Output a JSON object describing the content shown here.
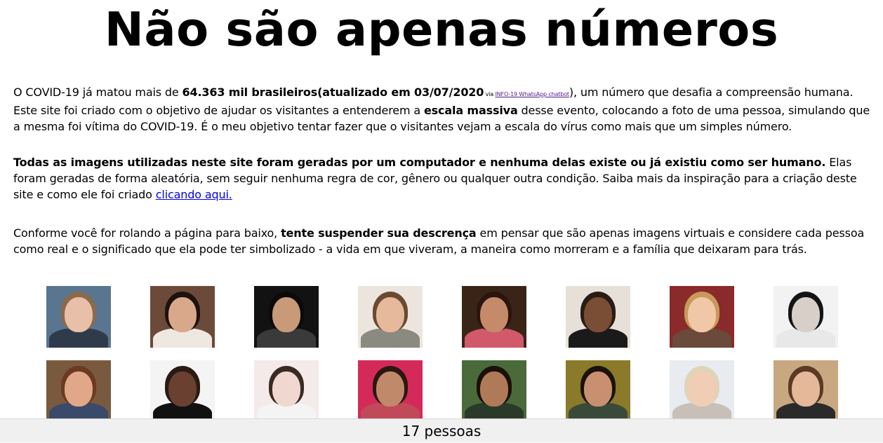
{
  "page": {
    "title": "Não são apenas números"
  },
  "intro": {
    "p1_a": "O COVID-19 já matou mais de ",
    "p1_bold": "64.363 mil brasileiros(atualizado em 03/07/2020",
    "p1_via": " via ",
    "p1_link": "INFO-19 WhatsApp chatbot",
    "p1_b": "), um número que desafia a compreensão humana. Este site foi criado com o objetivo de ajudar os visitantes a entenderem a ",
    "p1_bold2": "escala massiva",
    "p1_c": " desse evento, colocando a foto de uma pessoa, simulando que a mesma foi vítima do COVID-19. É o meu objetivo tentar fazer que o visitantes vejam a escala do vírus como mais que um simples número.",
    "p2_bold": "Todas as imagens utilizadas neste site foram geradas por um computador e nenhuma delas existe ou já existiu como ser humano.",
    "p2_a": " Elas foram geradas de forma aleatória, sem seguir nenhuma regra de cor, gênero ou qualquer outra condição. Saiba mais da inspiração para a criação deste site e como ele foi criado ",
    "p2_link": "clicando aqui.",
    "p3_a": "Conforme você for rolando a página para baixo, ",
    "p3_bold": "tente suspender sua descrença",
    "p3_b": " em pensar que são apenas imagens virtuais e considere cada pessoa como real e o significado que ela pode ter simbolizado - a vida em que viveram, a maneira como morreram e a família que deixaram para trás."
  },
  "faces": [
    {
      "bg": "#5a7590",
      "skin": "#e8bfa8",
      "hair": "#8a6a4a",
      "shirt": "#2f3b4a"
    },
    {
      "bg": "#6b4a3a",
      "skin": "#d9a88a",
      "hair": "#1c120e",
      "shirt": "#efe8e0"
    },
    {
      "bg": "#121212",
      "skin": "#c89a78",
      "hair": "#0a0a0a",
      "shirt": "#3a3a3a"
    },
    {
      "bg": "#ece5de",
      "skin": "#e6b89c",
      "hair": "#6a4a30",
      "shirt": "#8a8a80"
    },
    {
      "bg": "#3a2418",
      "skin": "#c58a6a",
      "hair": "#2a160e",
      "shirt": "#d05a6a"
    },
    {
      "bg": "#e6e0d8",
      "skin": "#7a4e34",
      "hair": "#2a1c14",
      "shirt": "#1a1a1a"
    },
    {
      "bg": "#8a2a2a",
      "skin": "#f0c8a8",
      "hair": "#c89a5a",
      "shirt": "#6a4a3a"
    },
    {
      "bg": "#f2f2f2",
      "skin": "#d8d0c8",
      "hair": "#141414",
      "shirt": "#e8e8e8"
    },
    {
      "bg": "#7a5a3e",
      "skin": "#e0a888",
      "hair": "#6a3a22",
      "shirt": "#3a4a6a"
    },
    {
      "bg": "#f4f4f4",
      "skin": "#6a4030",
      "hair": "#2a1a14",
      "shirt": "#111111"
    },
    {
      "bg": "#f4eaea",
      "skin": "#f0d8d0",
      "hair": "#3a2a22",
      "shirt": "#f4f4f4"
    },
    {
      "bg": "#d42a5a",
      "skin": "#c08a6a",
      "hair": "#2a1810",
      "shirt": "#c04a5a"
    },
    {
      "bg": "#4a6a3a",
      "skin": "#b07a58",
      "hair": "#1a100a",
      "shirt": "#2a3a2a"
    },
    {
      "bg": "#8a7a2a",
      "skin": "#c89070",
      "hair": "#1a120c",
      "shirt": "#3a4a3a"
    },
    {
      "bg": "#e8ecf0",
      "skin": "#f0cdb4",
      "hair": "#e0d4b8",
      "shirt": "#c8c0b8"
    },
    {
      "bg": "#c8a880",
      "skin": "#e4b898",
      "hair": "#5a3a22",
      "shirt": "#2a2a2a"
    }
  ],
  "footer": {
    "count": "17 pessoas"
  }
}
